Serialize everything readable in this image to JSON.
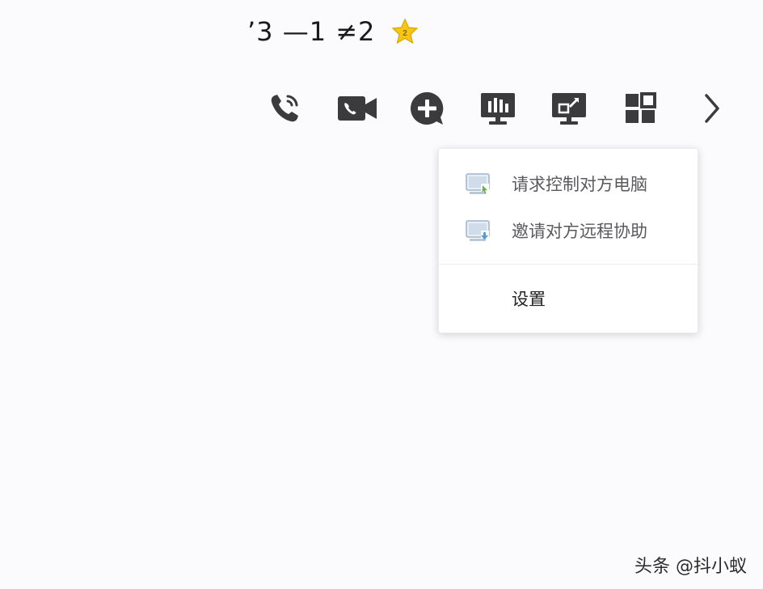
{
  "header": {
    "contact_name": "’3 —1 ≠2"
  },
  "toolbar": {
    "buttons": [
      {
        "icon": "phone-call-icon"
      },
      {
        "icon": "video-call-icon"
      },
      {
        "icon": "add-chat-icon"
      },
      {
        "icon": "screen-share-icon"
      },
      {
        "icon": "remote-desktop-icon"
      },
      {
        "icon": "apps-grid-icon"
      },
      {
        "icon": "chevron-right-icon"
      }
    ],
    "icon_color": "#3b3b3e"
  },
  "remote_menu": {
    "items": [
      {
        "label": "请求控制对方电脑",
        "icon": "request-control-icon"
      },
      {
        "label": "邀请对方远程协助",
        "icon": "invite-assist-icon"
      }
    ],
    "settings_label": "设置"
  },
  "watermark": {
    "text": "头条 @抖小蚁"
  },
  "colors": {
    "star": "#f5c518",
    "menu_icon_accent": "#6ab04c",
    "menu_icon_blue": "#5b9bd5"
  }
}
